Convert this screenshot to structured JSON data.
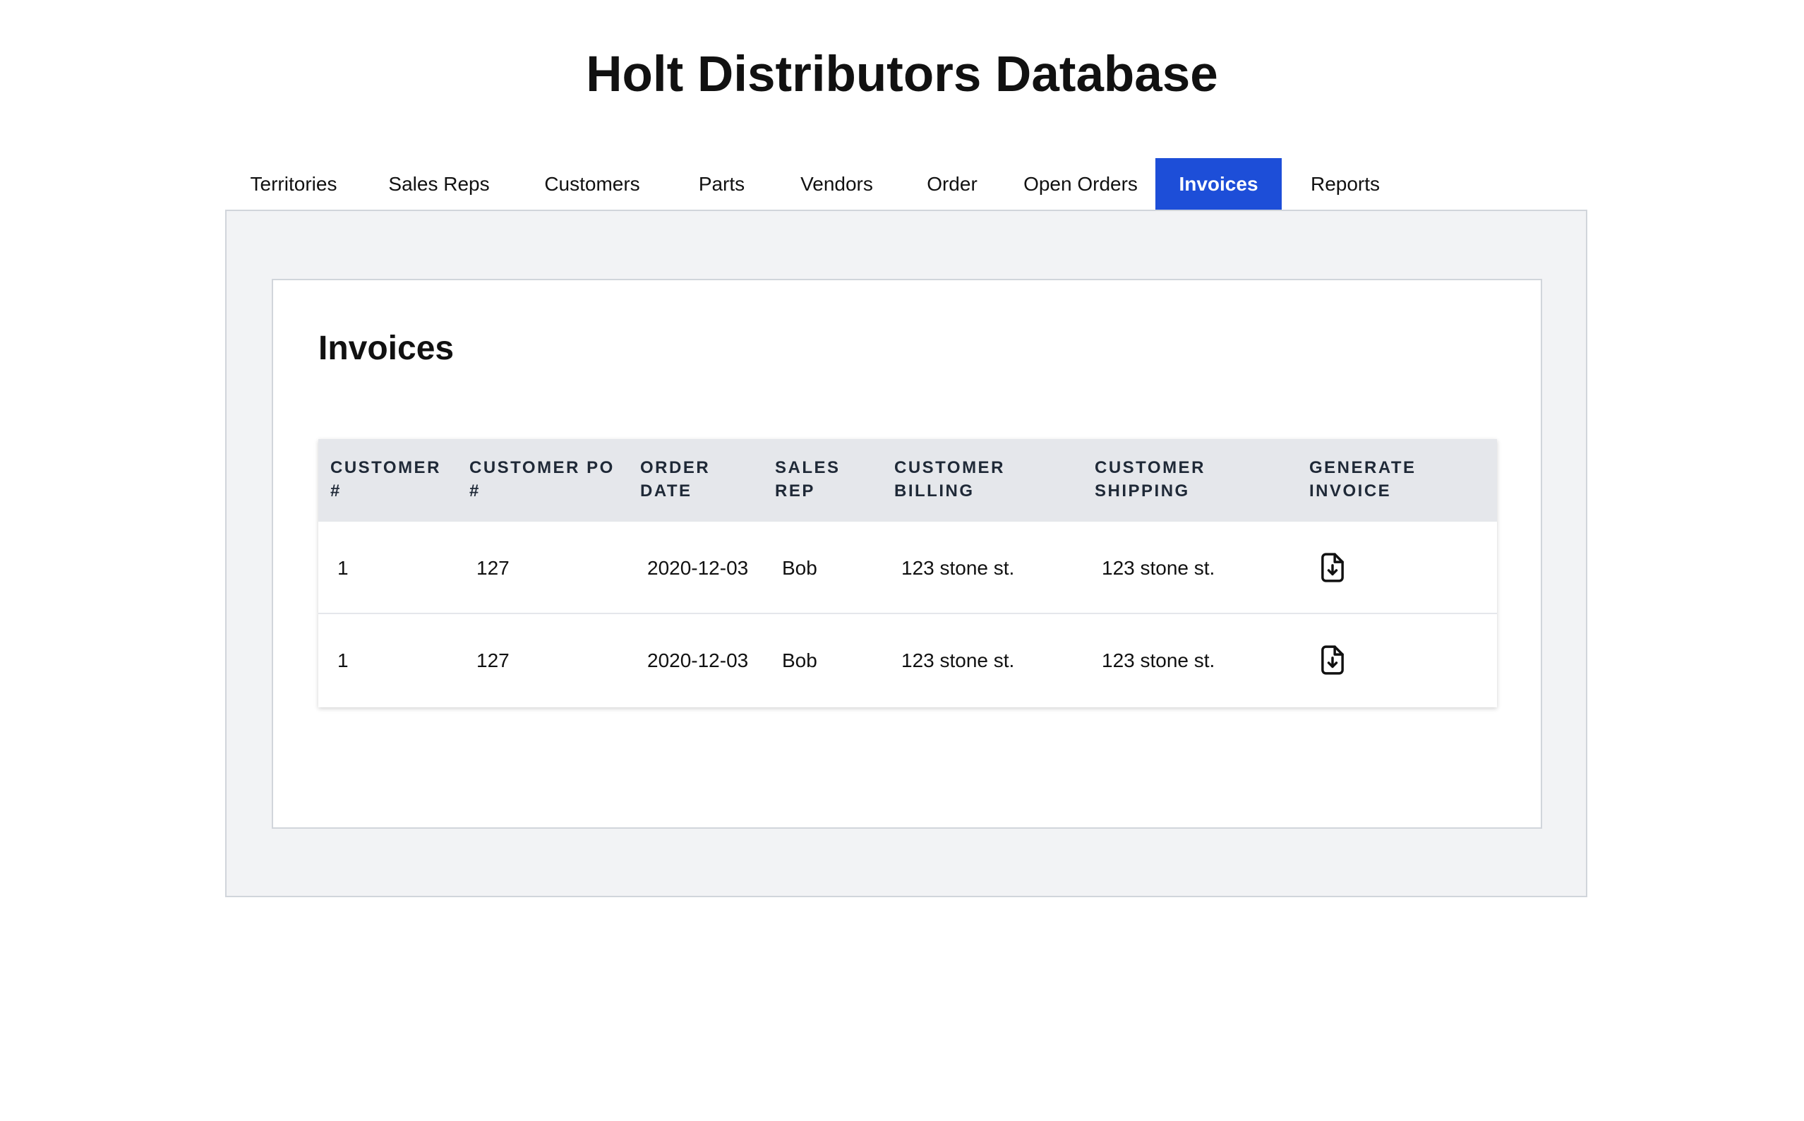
{
  "app": {
    "title": "Holt Distributors Database"
  },
  "tabs": [
    {
      "label": "Territories",
      "active": false
    },
    {
      "label": "Sales Reps",
      "active": false
    },
    {
      "label": "Customers",
      "active": false
    },
    {
      "label": "Parts",
      "active": false
    },
    {
      "label": "Vendors",
      "active": false
    },
    {
      "label": "Order",
      "active": false
    },
    {
      "label": "Open Orders",
      "active": false
    },
    {
      "label": "Invoices",
      "active": true
    },
    {
      "label": "Reports",
      "active": false
    }
  ],
  "colors": {
    "accent": "#1d4ed8",
    "panel_bg": "#f2f3f5",
    "header_bg": "#e5e7eb"
  },
  "main": {
    "heading": "Invoices",
    "table": {
      "columns": [
        {
          "line1": "CUSTOMER",
          "line2": "#"
        },
        {
          "line1": "CUSTOMER PO",
          "line2": "#"
        },
        {
          "line1": "ORDER",
          "line2": "DATE"
        },
        {
          "line1": "SALES",
          "line2": "REP"
        },
        {
          "line1": "CUSTOMER",
          "line2": "BILLING"
        },
        {
          "line1": "CUSTOMER",
          "line2": "SHIPPING"
        },
        {
          "line1": "GENERATE",
          "line2": "INVOICE"
        }
      ],
      "rows": [
        {
          "customer_num": "1",
          "customer_po": "127",
          "order_date": "2020-12-03",
          "sales_rep": "Bob",
          "billing": "123 stone st.",
          "shipping": "123 stone st.",
          "action_icon": "file-download-icon"
        },
        {
          "customer_num": "1",
          "customer_po": "127",
          "order_date": "2020-12-03",
          "sales_rep": "Bob",
          "billing": "123 stone st.",
          "shipping": "123 stone st.",
          "action_icon": "file-download-icon"
        }
      ]
    }
  }
}
